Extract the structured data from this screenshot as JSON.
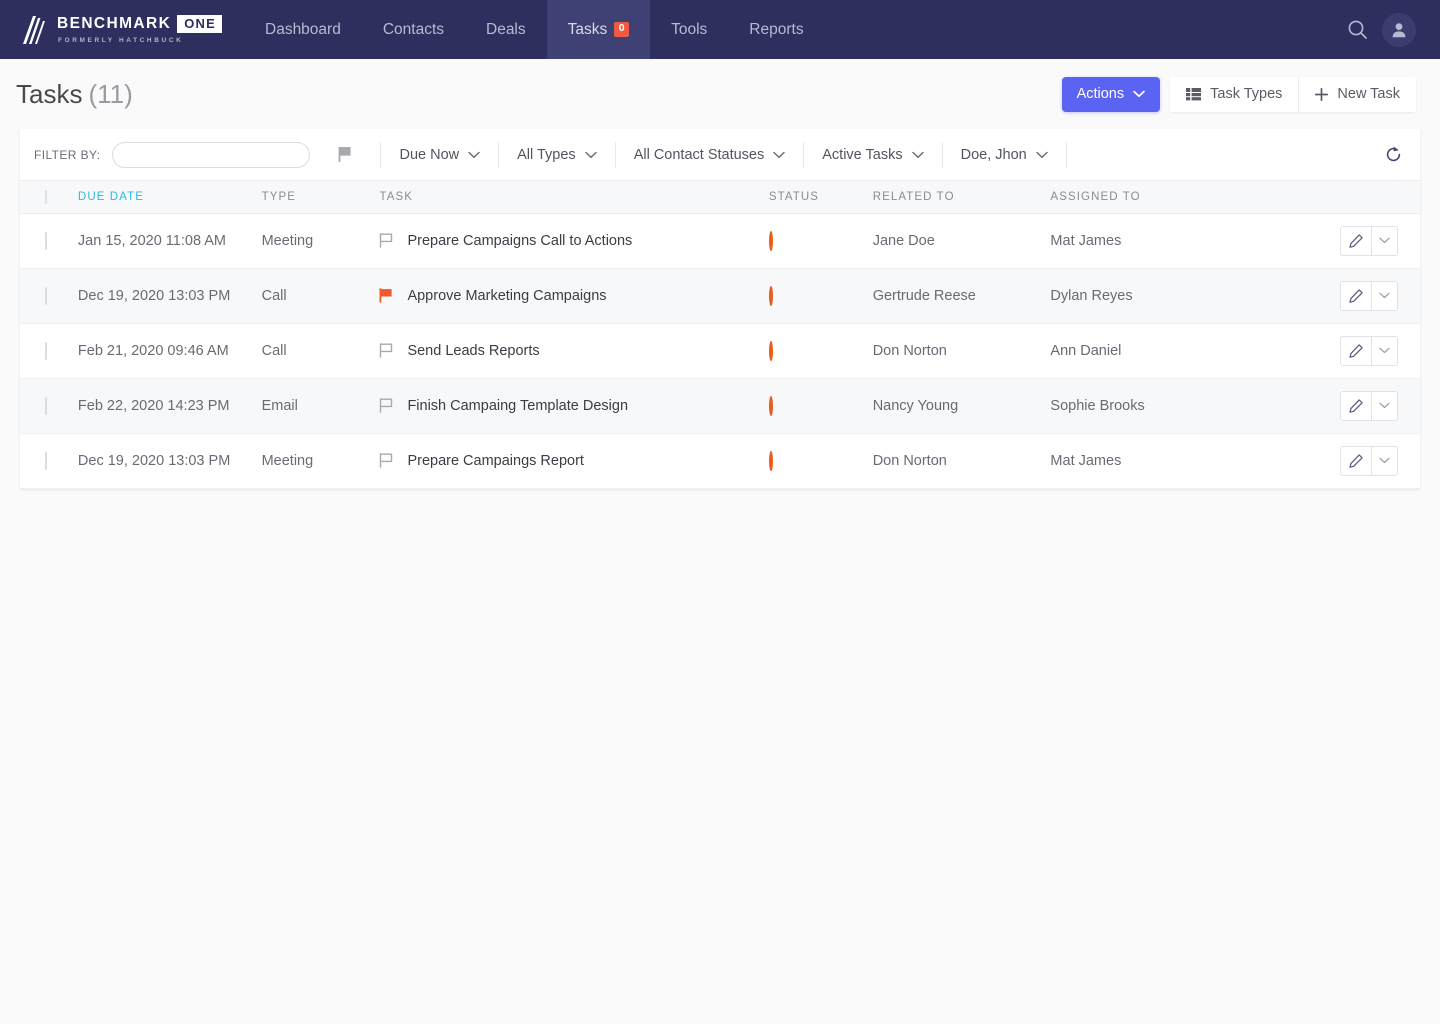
{
  "brand": {
    "name": "BENCHMARK",
    "badge": "ONE",
    "tagline": "FORMERLY HATCHBUCK",
    "logo_icon": "benchmark-slash-logo-icon"
  },
  "nav": {
    "items": [
      {
        "label": "Dashboard",
        "active": false,
        "badge": null
      },
      {
        "label": "Contacts",
        "active": false,
        "badge": null
      },
      {
        "label": "Deals",
        "active": false,
        "badge": null
      },
      {
        "label": "Tasks",
        "active": true,
        "badge": "0"
      },
      {
        "label": "Tools",
        "active": false,
        "badge": null
      },
      {
        "label": "Reports",
        "active": false,
        "badge": null
      }
    ],
    "search_icon": "search-icon",
    "avatar_icon": "user-avatar-icon"
  },
  "header": {
    "title": "Tasks",
    "count": "(11)",
    "actions_label": "Actions",
    "actions_caret_icon": "chevron-down-icon",
    "task_types_label": "Task Types",
    "task_types_icon": "list-grid-icon",
    "new_task_label": "New Task",
    "new_task_icon": "plus-icon"
  },
  "filters": {
    "label": "FILTER BY:",
    "search_value": "",
    "search_placeholder": "",
    "search_icon": "search-icon",
    "flag_icon": "flag-filled-icon",
    "dropdowns": [
      {
        "label": "Due Now"
      },
      {
        "label": "All Types"
      },
      {
        "label": "All Contact Statuses"
      },
      {
        "label": "Active Tasks"
      },
      {
        "label": "Doe, Jhon"
      }
    ],
    "refresh_icon": "refresh-icon"
  },
  "table": {
    "columns": [
      {
        "key": "due_date",
        "label": "DUE DATE",
        "sorted": true
      },
      {
        "key": "type",
        "label": "TYPE",
        "sorted": false
      },
      {
        "key": "task",
        "label": "TASK",
        "sorted": false
      },
      {
        "key": "status",
        "label": "STATUS",
        "sorted": false
      },
      {
        "key": "related_to",
        "label": "RELATED TO",
        "sorted": false
      },
      {
        "key": "assigned_to",
        "label": "ASSIGNED TO",
        "sorted": false
      }
    ],
    "rows": [
      {
        "due_date": "Jan 15, 2020 11:08 AM",
        "type": "Meeting",
        "task": "Prepare Campaigns Call to Actions",
        "flag": "outline",
        "status": "open",
        "related_to": "Jane Doe",
        "assigned_to": "Mat James"
      },
      {
        "due_date": "Dec 19, 2020 13:03 PM",
        "type": "Call",
        "task": "Approve Marketing Campaigns",
        "flag": "filled",
        "status": "open",
        "related_to": "Gertrude Reese",
        "assigned_to": "Dylan Reyes"
      },
      {
        "due_date": "Feb 21, 2020 09:46 AM",
        "type": "Call",
        "task": "Send Leads Reports",
        "flag": "outline",
        "status": "open",
        "related_to": "Don Norton",
        "assigned_to": "Ann Daniel"
      },
      {
        "due_date": "Feb 22, 2020 14:23 PM",
        "type": "Email",
        "task": "Finish Campaing Template Design",
        "flag": "outline",
        "status": "open",
        "related_to": "Nancy Young",
        "assigned_to": "Sophie Brooks"
      },
      {
        "due_date": "Dec 19, 2020 13:03 PM",
        "type": "Meeting",
        "task": "Prepare Campaings Report",
        "flag": "outline",
        "status": "open",
        "related_to": "Don Norton",
        "assigned_to": "Mat James"
      }
    ],
    "row_actions": {
      "edit_icon": "pencil-icon",
      "caret_icon": "chevron-down-icon"
    }
  },
  "colors": {
    "nav_bg": "#2e2f5e",
    "nav_active_bg": "#3f4073",
    "badge": "#ef5b40",
    "primary": "#5a63f2",
    "sorted_header": "#2fb8e8",
    "status_ring": "#eb5b1e",
    "flag_filled": "#f05a28",
    "page_bg": "#fafafa"
  }
}
